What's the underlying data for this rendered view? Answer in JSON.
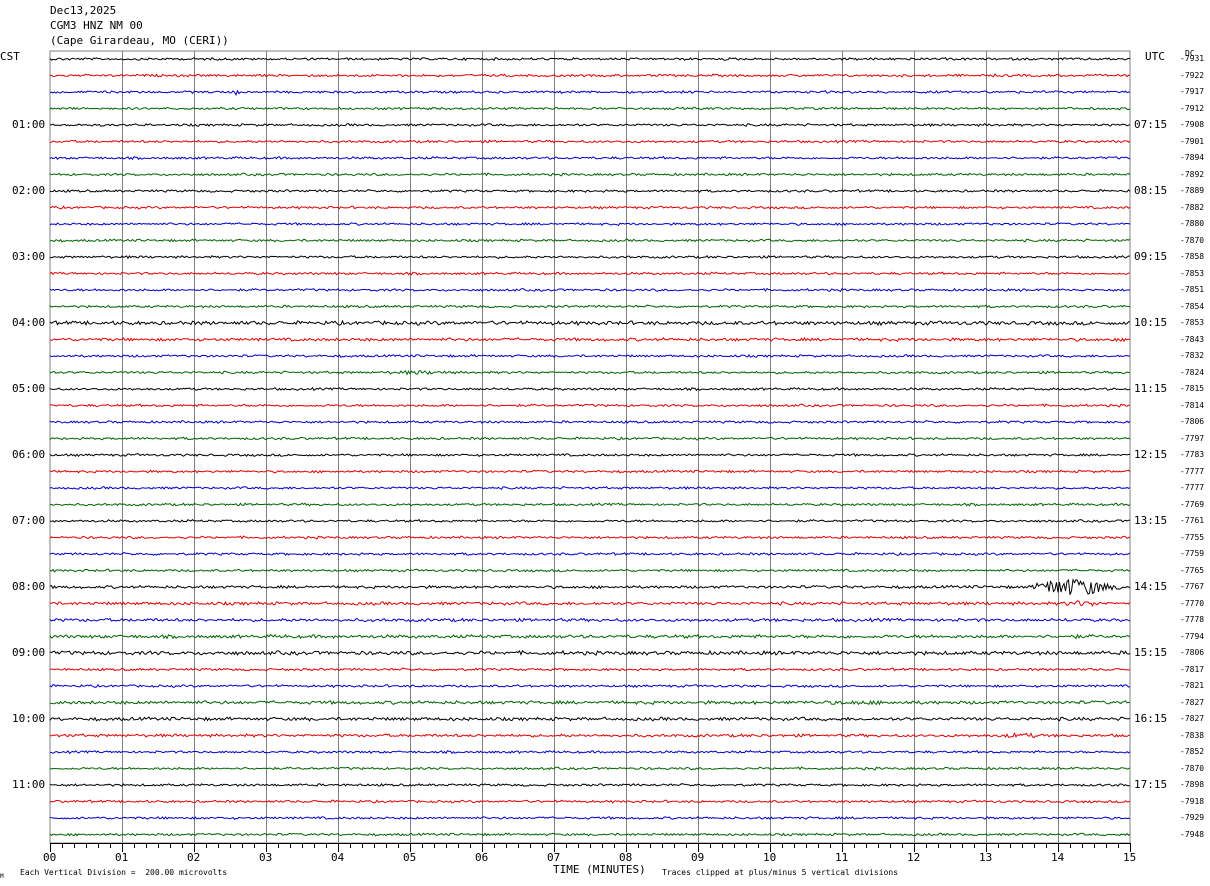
{
  "header": {
    "date": "Dec13,2025",
    "station": "CGM3 HNZ NM 00",
    "location": "(Cape Girardeau, MO (CERI))"
  },
  "left_timezone": "CST",
  "right_timezone": "UTC",
  "dc_label": "DC",
  "footer": {
    "division_note": "Each Vertical Division =  200.00 microvolts",
    "clip_note": "Traces clipped at plus/minus 5 vertical divisions",
    "corner_mark": "M"
  },
  "colors": {
    "black": "#000000",
    "red": "#e00000",
    "blue": "#0000c8",
    "green": "#006400",
    "grid": "#808080"
  },
  "chart_data": {
    "type": "line",
    "title": "CGM3 HNZ NM 00",
    "xlabel": "TIME (MINUTES)",
    "x_ticks": [
      "00",
      "01",
      "02",
      "03",
      "04",
      "05",
      "06",
      "07",
      "08",
      "09",
      "10",
      "11",
      "12",
      "13",
      "14",
      "15"
    ],
    "xlim": [
      0,
      15
    ],
    "trace_minutes": 15,
    "trace_colors_cycle": [
      "black",
      "red",
      "blue",
      "green"
    ],
    "left_hour_labels": [
      "01:00",
      "02:00",
      "03:00",
      "04:00",
      "05:00",
      "06:00",
      "07:00",
      "08:00",
      "09:00",
      "10:00",
      "11:00"
    ],
    "right_hour_labels": [
      "07:15",
      "08:15",
      "09:15",
      "10:15",
      "11:15",
      "12:15",
      "13:15",
      "14:15",
      "15:15",
      "16:15",
      "17:15"
    ],
    "trace_dc_offsets": [
      "-7931",
      "-7922",
      "-7917",
      "-7912",
      "-7908",
      "-7901",
      "-7894",
      "-7892",
      "-7889",
      "-7882",
      "-7880",
      "-7870",
      "-7858",
      "-7853",
      "-7851",
      "-7854",
      "-7853",
      "-7843",
      "-7832",
      "-7824",
      "-7815",
      "-7814",
      "-7806",
      "-7797",
      "-7783",
      "-7777",
      "-7777",
      "-7769",
      "-7761",
      "-7755",
      "-7759",
      "-7765",
      "-7767",
      "-7770",
      "-7778",
      "-7794",
      "-7806",
      "-7817",
      "-7821",
      "-7827",
      "-7827",
      "-7838",
      "-7852",
      "-7870",
      "-7898",
      "-7918",
      "-7929",
      "-7948"
    ],
    "noise_levels": [
      1,
      1,
      1,
      1,
      1,
      1,
      1,
      1,
      1,
      1,
      1,
      1,
      1,
      1,
      1,
      1,
      1.6,
      1.3,
      1,
      1,
      1,
      1,
      1,
      1,
      1,
      1,
      1,
      1,
      1,
      1,
      1,
      1,
      1.2,
      1.3,
      1.3,
      1.4,
      1.6,
      1,
      1,
      1.4,
      1.4,
      1.2,
      1,
      1,
      1,
      1,
      1,
      1
    ],
    "events": [
      {
        "trace": 2,
        "minute": 2.55,
        "amplitude": 4,
        "duration": 0.1
      },
      {
        "trace": 19,
        "minute": 4.5,
        "amplitude": 2,
        "duration": 1.5
      },
      {
        "trace": 32,
        "minute": 13.65,
        "amplitude": 9,
        "duration": 1.3
      },
      {
        "trace": 33,
        "minute": 14.0,
        "amplitude": 3,
        "duration": 0.8
      },
      {
        "trace": 35,
        "minute": 14.1,
        "amplitude": 2,
        "duration": 0.4
      },
      {
        "trace": 39,
        "minute": 10.0,
        "amplitude": 2,
        "duration": 3.0
      },
      {
        "trace": 41,
        "minute": 13.1,
        "amplitude": 2.5,
        "duration": 0.9
      }
    ]
  }
}
